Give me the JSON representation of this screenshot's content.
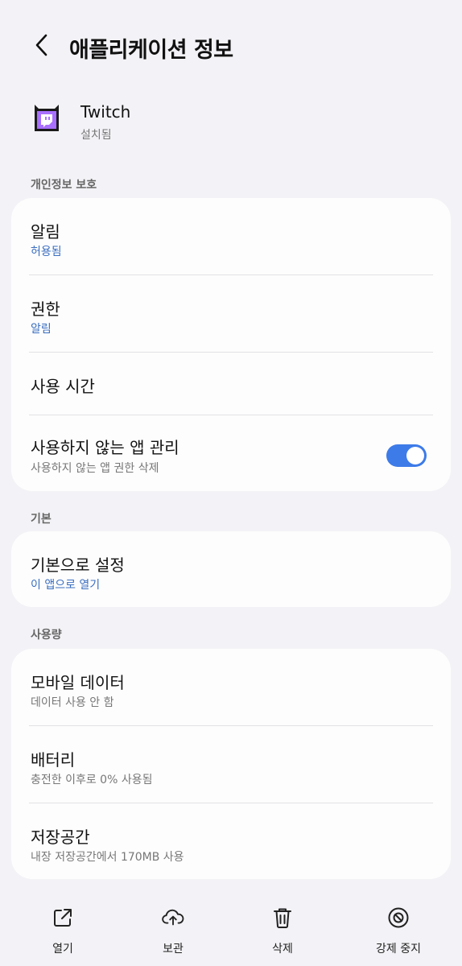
{
  "header": {
    "title": "애플리케이션 정보"
  },
  "app": {
    "name": "Twitch",
    "status": "설치됨",
    "icon": "twitch-app-icon"
  },
  "sections": {
    "privacy": {
      "label": "개인정보 보호",
      "notifications": {
        "title": "알림",
        "sub": "허용됨"
      },
      "permissions": {
        "title": "권한",
        "sub": "알림"
      },
      "usage_time": {
        "title": "사용 시간"
      },
      "unused_apps": {
        "title": "사용하지 않는 앱 관리",
        "sub": "사용하지 않는 앱 권한 삭제",
        "toggle_on": true
      }
    },
    "defaults": {
      "label": "기본",
      "set_default": {
        "title": "기본으로 설정",
        "sub": "이 앱으로 열기"
      }
    },
    "usage": {
      "label": "사용량",
      "mobile_data": {
        "title": "모바일 데이터",
        "sub": "데이터 사용 안 함"
      },
      "battery": {
        "title": "배터리",
        "sub": "충전한 이후로 0% 사용됨"
      },
      "storage": {
        "title": "저장공간",
        "sub": "내장 저장공간에서 170MB 사용"
      }
    }
  },
  "bottom_bar": {
    "open": "열기",
    "archive": "보관",
    "uninstall": "삭제",
    "force_stop": "강제 중지"
  },
  "colors": {
    "accent": "#3d7be8",
    "link": "#3a6ec0",
    "background": "#f3f3f7",
    "card": "#fdfdfd"
  }
}
